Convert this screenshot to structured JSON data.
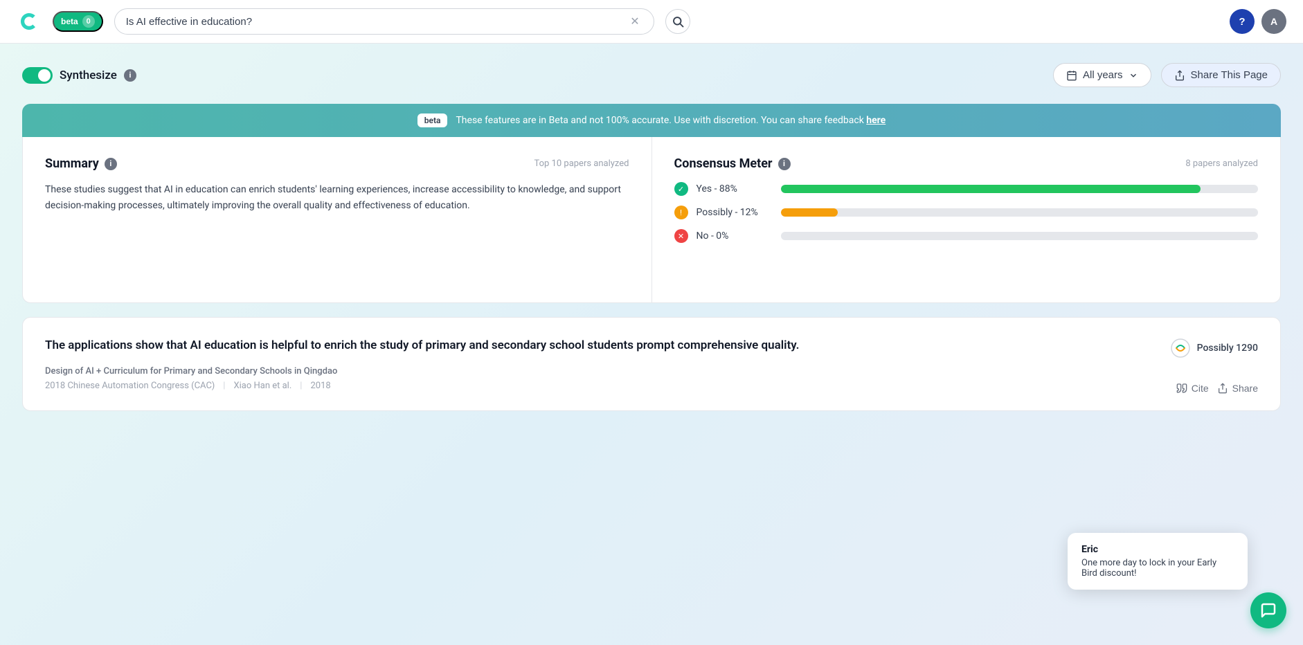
{
  "header": {
    "logo_text": "C",
    "beta_label": "beta",
    "beta_count": "0",
    "search_value": "Is AI effective in education?",
    "search_placeholder": "Is AI effective in education?",
    "help_label": "?",
    "avatar_label": "A"
  },
  "controls": {
    "synthesize_label": "Synthesize",
    "info_label": "i",
    "all_years_label": "All years",
    "share_label": "Share This Page"
  },
  "beta_banner": {
    "tag": "beta",
    "text": "These features are in Beta and not 100% accurate. Use with discretion. You can share feedback ",
    "link_text": "here"
  },
  "summary": {
    "title": "Summary",
    "meta": "Top 10 papers analyzed",
    "text": "These studies suggest that AI in education can enrich students' learning experiences, increase accessibility to knowledge, and support decision-making processes, ultimately improving the overall quality and effectiveness of education."
  },
  "consensus": {
    "title": "Consensus Meter",
    "meta": "8 papers analyzed",
    "rows": [
      {
        "label": "Yes - 88%",
        "pct": 88,
        "type": "yes"
      },
      {
        "label": "Possibly - 12%",
        "pct": 12,
        "type": "possibly"
      },
      {
        "label": "No - 0%",
        "pct": 0,
        "type": "no"
      }
    ]
  },
  "article": {
    "quote": "The applications show that AI education is helpful to enrich the study of primary and secondary school students prompt comprehensive quality.",
    "title": "Design of AI + Curriculum for Primary and Secondary Schools in Qingdao",
    "journal": "2018 Chinese Automation Congress (CAC)",
    "authors": "Xiao Han et al.",
    "year": "2018",
    "possibly_count": "Possibly 1290",
    "cite_label": "Cite",
    "share_label": "Share"
  },
  "notification": {
    "name": "Eric",
    "text": "One more day to lock in your Early Bird discount!"
  },
  "icons": {
    "calendar": "📅",
    "chevron_down": "∨",
    "upload": "↑",
    "search": "🔍",
    "quote": "❞",
    "share_up": "↑",
    "synth_arrows": "⟳"
  }
}
